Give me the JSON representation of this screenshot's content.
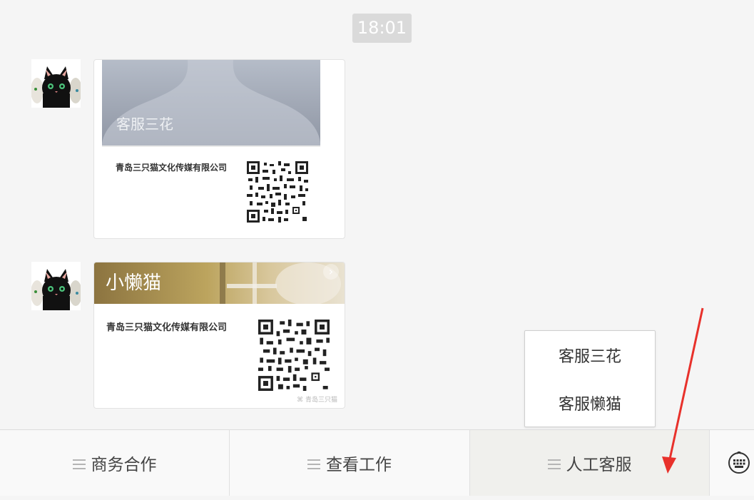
{
  "timestamp": "18:01",
  "messages": [
    {
      "card_name": "客服三花",
      "company": "青岛三只猫文化传媒有限公司"
    },
    {
      "card_name": "小懒猫",
      "company": "青岛三只猫文化传媒有限公司",
      "watermark": "青岛三只猫"
    }
  ],
  "popup_menu": {
    "items": [
      "客服三花",
      "客服懒猫"
    ]
  },
  "menu_bar": {
    "buttons": [
      "商务合作",
      "查看工作",
      "人工客服"
    ],
    "keyboard_icon": "keyboard-icon",
    "menu_icon": "menu-lines-icon"
  },
  "colors": {
    "annotation_arrow": "#e8312b"
  }
}
